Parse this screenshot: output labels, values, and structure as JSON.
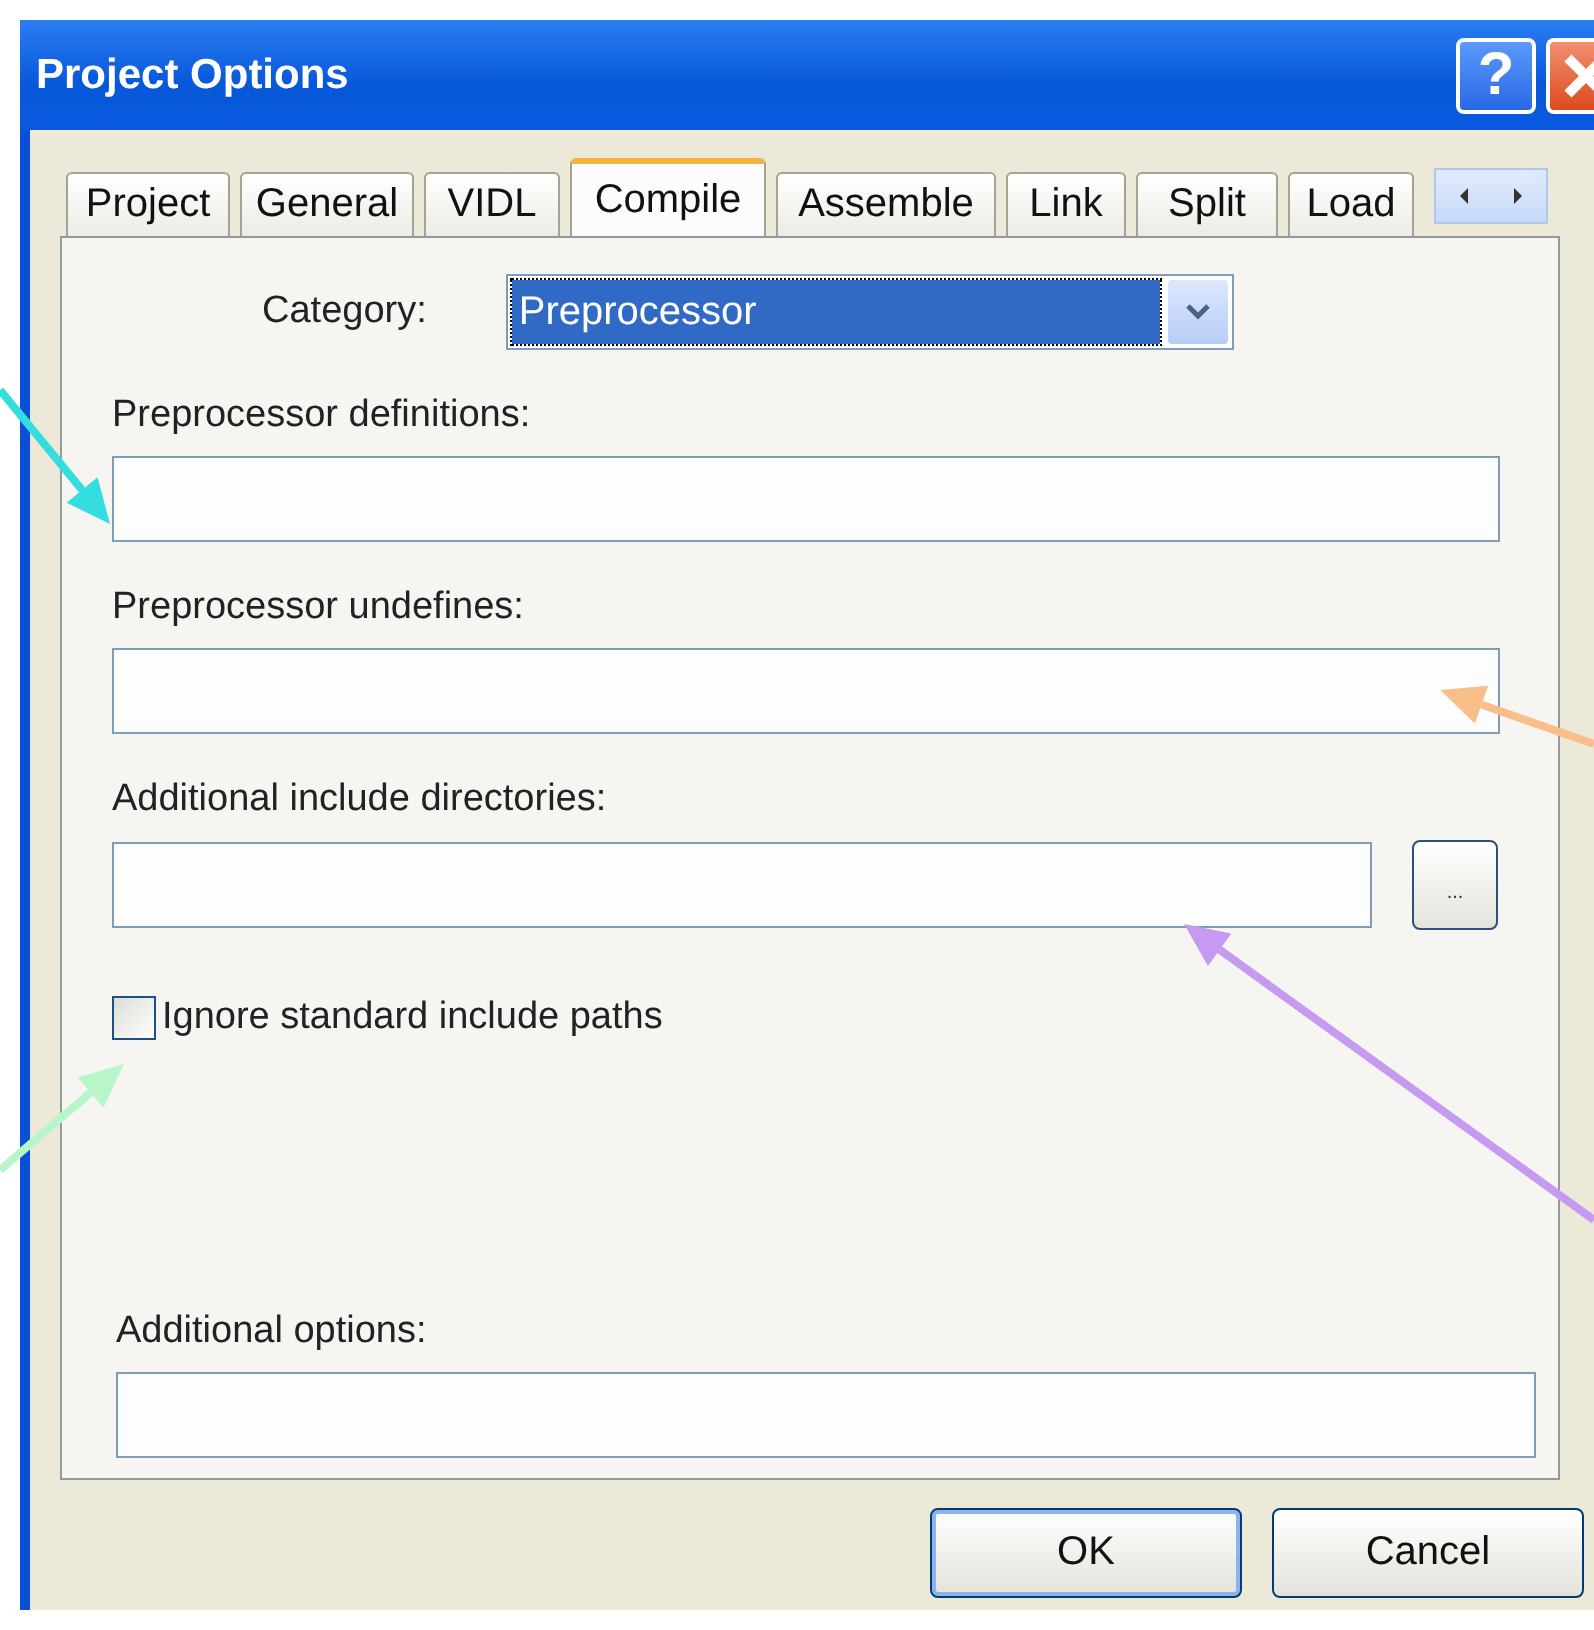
{
  "window": {
    "title": "Project Options",
    "help_button": "?"
  },
  "tabs": [
    {
      "label": "Project",
      "selected": false
    },
    {
      "label": "General",
      "selected": false
    },
    {
      "label": "VIDL",
      "selected": false
    },
    {
      "label": "Compile",
      "selected": true
    },
    {
      "label": "Assemble",
      "selected": false
    },
    {
      "label": "Link",
      "selected": false
    },
    {
      "label": "Split",
      "selected": false
    },
    {
      "label": "Load",
      "selected": false
    }
  ],
  "category": {
    "label": "Category:",
    "value": "Preprocessor"
  },
  "fields": [
    {
      "kind": "text",
      "label": "Preprocessor definitions:"
    },
    {
      "kind": "text",
      "label": "Preprocessor undefines:"
    },
    {
      "kind": "browse",
      "label": "Additional include directories:",
      "button": "..."
    },
    {
      "kind": "checkbox",
      "label": "Ignore standard include paths",
      "checked": false
    },
    {
      "kind": "options",
      "label": "Additional options:"
    }
  ],
  "buttons": [
    "OK",
    "Cancel"
  ],
  "annotations": [
    {
      "color": "#33dde0"
    },
    {
      "color": "#f8bf8a"
    },
    {
      "color": "#c59af0"
    },
    {
      "color": "#b8f5c8"
    }
  ]
}
